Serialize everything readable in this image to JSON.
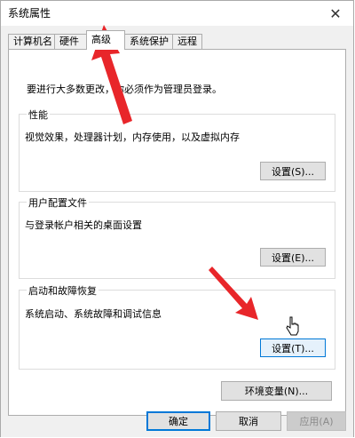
{
  "window": {
    "title": "系统属性",
    "close_glyph": "✕"
  },
  "tabs": [
    {
      "label": "计算机名"
    },
    {
      "label": "硬件"
    },
    {
      "label": "高级",
      "active": true
    },
    {
      "label": "系统保护"
    },
    {
      "label": "远程"
    }
  ],
  "admin_note": "要进行大多数更改，你必须作为管理员登录。",
  "groups": {
    "performance": {
      "title": "性能",
      "desc": "视觉效果，处理器计划，内存使用，以及虚拟内存",
      "button": "设置(S)..."
    },
    "profiles": {
      "title": "用户配置文件",
      "desc": "与登录帐户相关的桌面设置",
      "button": "设置(E)..."
    },
    "startup": {
      "title": "启动和故障恢复",
      "desc": "系统启动、系统故障和调试信息",
      "button": "设置(T)..."
    }
  },
  "env_button": "环境变量(N)...",
  "footer": {
    "ok": "确定",
    "cancel": "取消",
    "apply": "应用(A)"
  },
  "colors": {
    "arrow": "#e8262a",
    "accent": "#0078d7",
    "hover_fill": "#e5f1fb"
  },
  "icons": {
    "close": "close-icon",
    "cursor": "mouse-pointer-icon",
    "arrow": "red-arrow-annotation"
  }
}
